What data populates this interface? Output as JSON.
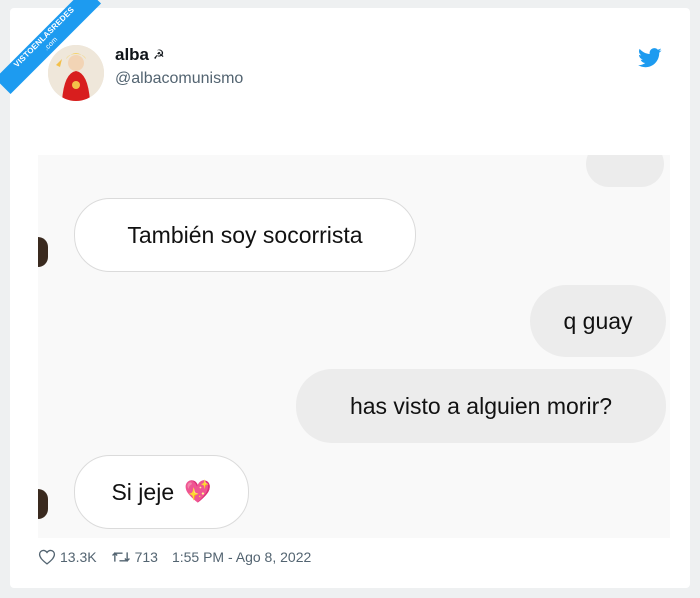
{
  "watermark": {
    "line1": "VISTOENLASREDES",
    "line2": ".com"
  },
  "tweet": {
    "author_name": "alba",
    "author_emoji": "☭",
    "handle": "@albacomunismo",
    "likes": "13.3K",
    "retweets": "713",
    "timestamp": "1:55 PM - Ago 8, 2022"
  },
  "chat": {
    "messages": [
      {
        "side": "received",
        "text": "También soy socorrista"
      },
      {
        "side": "sent",
        "text": "q guay"
      },
      {
        "side": "sent",
        "text": "has visto a alguien morir?"
      },
      {
        "side": "received",
        "text": "Si jeje",
        "emoji": "💖"
      }
    ]
  },
  "colors": {
    "twitter_blue": "#1d9bf0",
    "secondary_text": "#536471"
  }
}
